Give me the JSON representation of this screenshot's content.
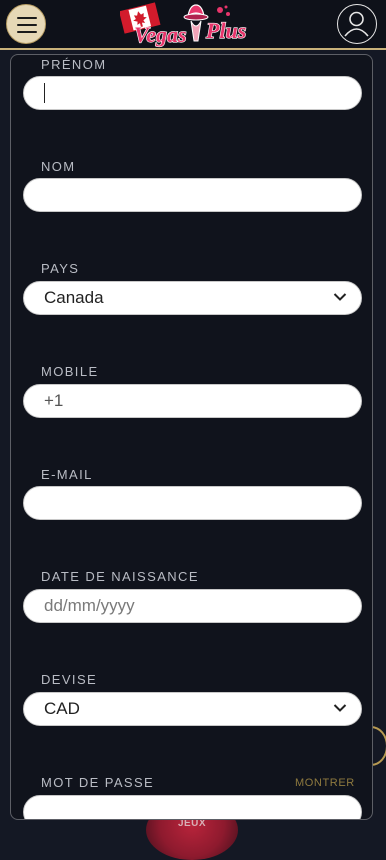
{
  "header": {
    "logo_text": "Vegas Plus",
    "menu_icon": "hamburger-icon",
    "user_icon": "user-icon"
  },
  "background": {
    "orb_label": "JEUX"
  },
  "form": {
    "prenom": {
      "label": "PRÉNOM",
      "value": ""
    },
    "nom": {
      "label": "NOM",
      "value": ""
    },
    "pays": {
      "label": "PAYS",
      "value": "Canada"
    },
    "mobile": {
      "label": "MOBILE",
      "value": "+1"
    },
    "email": {
      "label": "E-MAIL",
      "value": ""
    },
    "dob": {
      "label": "DATE DE NAISSANCE",
      "placeholder": "dd/mm/yyyy"
    },
    "devise": {
      "label": "DEVISE",
      "value": "CAD"
    },
    "password": {
      "label": "MOT DE PASSE",
      "show_label": "MONTRER",
      "value": ""
    }
  },
  "colors": {
    "accent_gold": "#c9b27a",
    "modal_bg": "#10131c",
    "page_bg": "#141824",
    "logo_pink": "#e7356b"
  }
}
